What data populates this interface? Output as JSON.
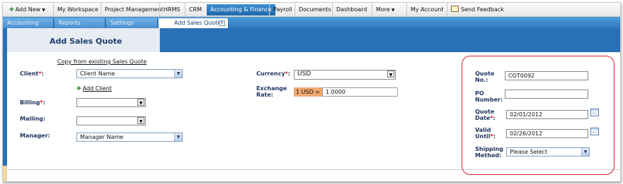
{
  "topnav": {
    "add_new": "Add New",
    "items": [
      "My Workspace",
      "Project Management",
      "HRMS",
      "CRM",
      "Accounting & Finance",
      "Payroll",
      "Documents",
      "Dashboard",
      "More",
      "My Account",
      "Send Feedback"
    ],
    "active": "Accounting & Finance"
  },
  "subtabs": [
    "Accounting",
    "Reports",
    "Settings",
    "Add Sales Quote"
  ],
  "page": {
    "title": "Add Sales Quote"
  },
  "form": {
    "copy_link": "Copy from existing Sales Quote",
    "client_label": "Client",
    "client_value": "Client Name",
    "add_client": "Add Client",
    "billing_label": "Billing",
    "billing_value": "",
    "mailing_label": "Mailing:",
    "mailing_value": "",
    "manager_label": "Manager:",
    "manager_value": "Manager Name",
    "currency_label": "Currency",
    "currency_value": "USD",
    "exchange_label_1": "Exchange",
    "exchange_label_2": "Rate:",
    "rate_prefix": "1 USD =",
    "rate_value": "1.0000",
    "required_mark": "*",
    "colon": ":"
  },
  "quote": {
    "quote_no_label_1": "Quote",
    "quote_no_label_2": "No.:",
    "quote_no_value": "COT0092",
    "po_label_1": "PO",
    "po_label_2": "Number:",
    "po_value": "",
    "date_label_1": "Quote",
    "date_label_2": "Date",
    "date_value": "02/01/2012",
    "valid_label_1": "Valid",
    "valid_label_2": "Until",
    "valid_value": "02/26/2012",
    "ship_label_1": "Shipping",
    "ship_label_2": "Method:",
    "ship_value": "Please Select"
  },
  "colors": {
    "nav_active": "#2a73b8",
    "header_band": "#2a70b5",
    "highlight": "#d51f2a",
    "rate_tag": "#f0a870"
  },
  "icons": [
    "plus-icon",
    "caret-icon",
    "feedback-icon",
    "close-icon",
    "calendar-icon",
    "dropdown-arrow-icon"
  ]
}
